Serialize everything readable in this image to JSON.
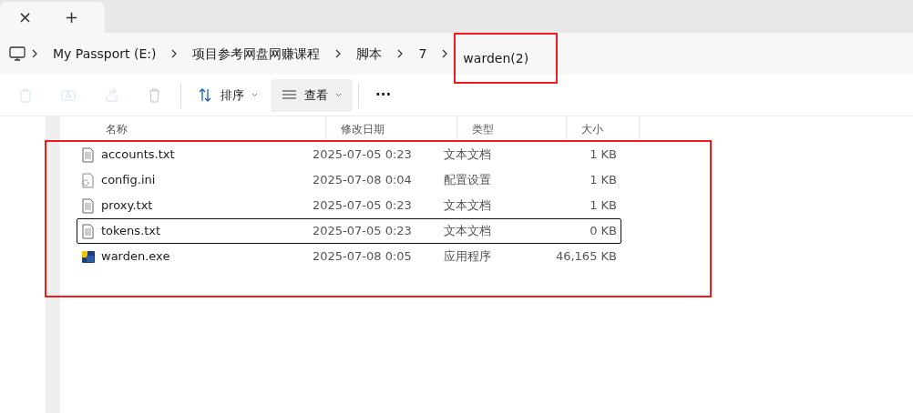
{
  "tabs": [
    {
      "label": "×",
      "kind": "close"
    },
    {
      "label": "+",
      "kind": "new"
    }
  ],
  "breadcrumb": [
    {
      "label": "My Passport (E:)",
      "highlighted": false
    },
    {
      "label": "项目参考网盘网赚课程",
      "highlighted": false
    },
    {
      "label": "脚本",
      "highlighted": false
    },
    {
      "label": "7",
      "highlighted": false
    },
    {
      "label": "warden(2)",
      "highlighted": true
    }
  ],
  "toolbar": [
    {
      "kind": "copy",
      "disabled": true
    },
    {
      "kind": "rename",
      "disabled": true
    },
    {
      "kind": "share",
      "disabled": true
    },
    {
      "kind": "delete",
      "disabled": true
    },
    {
      "kind": "sort",
      "label": "排序",
      "disabled": false,
      "selected": false
    },
    {
      "kind": "view",
      "label": "查看",
      "disabled": false,
      "selected": true
    },
    {
      "kind": "more",
      "label": "···",
      "disabled": false,
      "selected": false
    }
  ],
  "table": {
    "columns": [
      "名称",
      "修改日期",
      "类型",
      "大小"
    ],
    "highlighted": true,
    "rows": [
      {
        "kind": "text",
        "name": "accounts.txt",
        "date": "2025-07-05 0:23",
        "type": "文本文档",
        "size": "1 KB",
        "focused": false
      },
      {
        "kind": "config",
        "name": "config.ini",
        "date": "2025-07-08 0:04",
        "type": "配置设置",
        "size": "1 KB",
        "focused": false
      },
      {
        "kind": "text",
        "name": "proxy.txt",
        "date": "2025-07-05 0:23",
        "type": "文本文档",
        "size": "1 KB",
        "focused": false
      },
      {
        "kind": "text",
        "name": "tokens.txt",
        "date": "2025-07-05 0:23",
        "type": "文本文档",
        "size": "0 KB",
        "focused": true
      },
      {
        "kind": "exe",
        "name": "warden.exe",
        "date": "2025-07-08 0:05",
        "type": "应用程序",
        "size": "46,165 KB",
        "focused": false
      }
    ]
  }
}
